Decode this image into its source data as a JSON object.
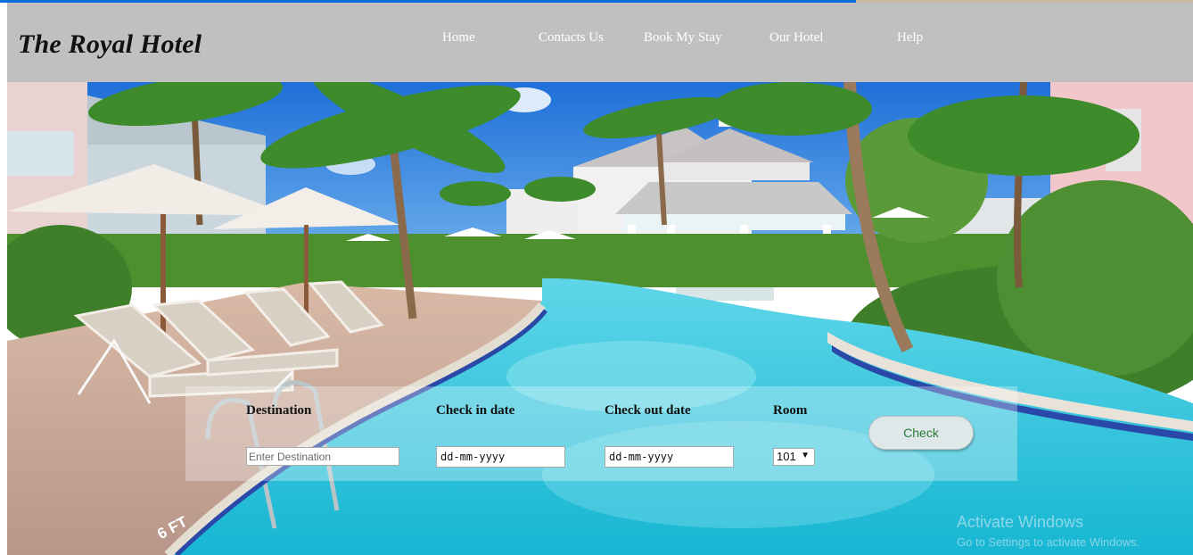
{
  "header": {
    "logo": "The Royal Hotel",
    "nav": [
      "Home",
      "Contacts Us",
      "Book My Stay",
      "Our Hotel",
      "Help"
    ]
  },
  "hero": {
    "image": "resort-pool-photo",
    "pool_marking": "6 FT"
  },
  "search": {
    "destination_label": "Destination",
    "destination_placeholder": "Enter Destination",
    "checkin_label": "Check in date",
    "checkin_value": "dd-mm-yyyy",
    "checkout_label": "Check out date",
    "checkout_value": "dd-mm-yyyy",
    "room_label": "Room",
    "room_value": "101",
    "room_caret": "▼",
    "check_label": "Check"
  },
  "watermark": {
    "title": "Activate Windows",
    "subtitle": "Go to Settings to activate Windows."
  },
  "colors": {
    "header_bg": "#c0c0c0",
    "pool": "#3cc8df",
    "button_text": "#2a7a3a"
  }
}
